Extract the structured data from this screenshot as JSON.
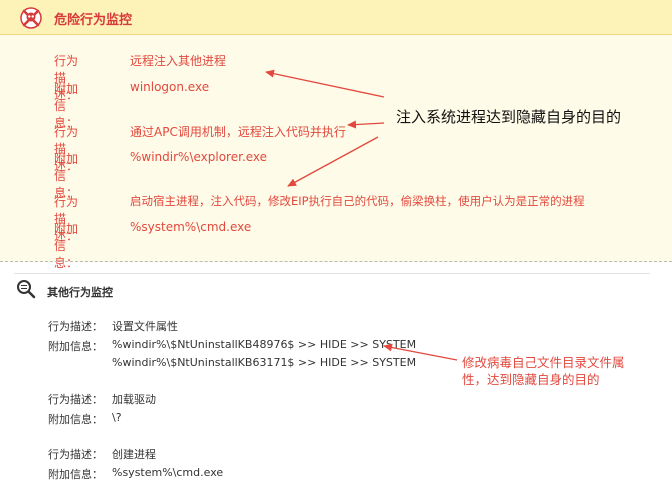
{
  "danger_section": {
    "title": "危险行为监控",
    "entries": [
      {
        "desc_label": "行为描述：",
        "desc_value": "远程注入其他进程",
        "info_label": "附加信息：",
        "info_value": "winlogon.exe"
      },
      {
        "desc_label": "行为描述：",
        "desc_value": "通过APC调用机制，远程注入代码并执行",
        "info_label": "附加信息：",
        "info_value": "%windir%\\explorer.exe"
      },
      {
        "desc_label": "行为描述：",
        "desc_value": "启动宿主进程，注入代码，修改EIP执行自己的代码，偷梁换柱，使用户认为是正常的进程",
        "info_label": "附加信息：",
        "info_value": "%system%\\cmd.exe"
      }
    ],
    "annotation": "注入系统进程达到隐藏自身的目的"
  },
  "other_section": {
    "title": "其他行为监控",
    "entries": [
      {
        "desc_label": "行为描述：",
        "desc_value": "设置文件属性",
        "info_label": "附加信息：",
        "info_lines": [
          "%windir%\\$NtUninstallKB48976$ >> HIDE >> SYSTEM",
          "%windir%\\$NtUninstallKB63171$ >> HIDE >> SYSTEM"
        ]
      },
      {
        "desc_label": "行为描述：",
        "desc_value": "加载驱动",
        "info_label": "附加信息：",
        "info_lines": [
          "\\?"
        ]
      },
      {
        "desc_label": "行为描述：",
        "desc_value": "创建进程",
        "info_label": "附加信息：",
        "info_lines": [
          "%system%\\cmd.exe"
        ]
      }
    ],
    "annotation_lines": [
      "修改病毒自己文件目录文件属",
      "性，达到隐藏自身的目的"
    ]
  },
  "icons": {
    "danger": "skull-crossbones-icon",
    "other": "magnifier-icon"
  },
  "colors": {
    "header_bg": "#fdf3b8",
    "panel_bg": "#fffbe9",
    "danger_text": "#e2483d",
    "arrow": "#e2483d"
  }
}
